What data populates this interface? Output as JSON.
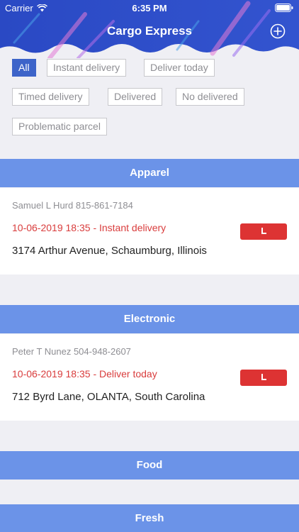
{
  "status": {
    "carrier": "Carrier",
    "time": "6:35 PM"
  },
  "header": {
    "title": "Cargo Express"
  },
  "filters": [
    {
      "label": "All",
      "active": true
    },
    {
      "label": "Instant delivery",
      "active": false
    },
    {
      "label": "Deliver today",
      "active": false
    },
    {
      "label": "Timed delivery",
      "active": false
    },
    {
      "label": "Delivered",
      "active": false
    },
    {
      "label": "No delivered",
      "active": false
    },
    {
      "label": "Problematic parcel",
      "active": false
    }
  ],
  "sections": [
    {
      "title": "Apparel",
      "items": [
        {
          "sender": "Samuel L Hurd 815-861-7184",
          "datetime": "10-06-2019 18:35",
          "type": "- Instant delivery",
          "address": "3174 Arthur Avenue, Schaumburg, Illinois"
        }
      ]
    },
    {
      "title": "Electronic",
      "items": [
        {
          "sender": "Peter T Nunez 504-948-2607",
          "datetime": "10-06-2019 18:35",
          "type": "- Deliver today",
          "address": "712 Byrd Lane, OLANTA, South Carolina"
        }
      ]
    },
    {
      "title": "Food",
      "items": []
    },
    {
      "title": "Fresh",
      "items": []
    }
  ],
  "colors": {
    "header": "#2f50c8",
    "accent": "#6b93e8",
    "alert": "#dd3333"
  },
  "icons": {
    "add": "add-circle-icon",
    "wifi": "wifi-icon",
    "battery": "battery-icon",
    "tag": "tag-icon"
  }
}
